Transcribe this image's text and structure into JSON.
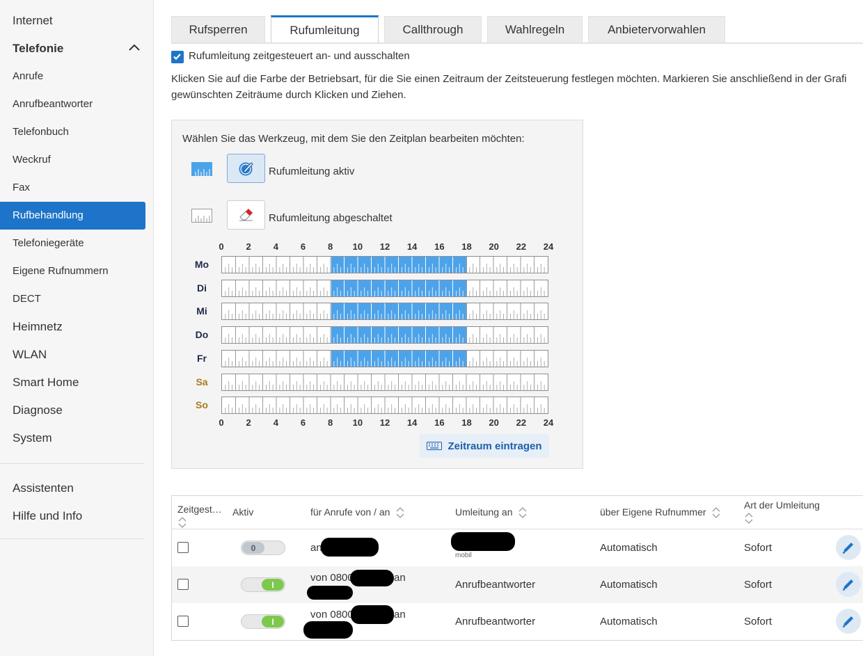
{
  "sidebar": {
    "items": [
      {
        "label": "Internet"
      },
      {
        "label": "Telefonie"
      },
      {
        "label": "Anrufe"
      },
      {
        "label": "Anrufbeantworter"
      },
      {
        "label": "Telefonbuch"
      },
      {
        "label": "Weckruf"
      },
      {
        "label": "Fax"
      },
      {
        "label": "Rufbehandlung"
      },
      {
        "label": "Telefoniegeräte"
      },
      {
        "label": "Eigene Rufnummern"
      },
      {
        "label": "DECT"
      },
      {
        "label": "Heimnetz"
      },
      {
        "label": "WLAN"
      },
      {
        "label": "Smart Home"
      },
      {
        "label": "Diagnose"
      },
      {
        "label": "System"
      },
      {
        "label": "Assistenten"
      },
      {
        "label": "Hilfe und Info"
      }
    ],
    "active": "Rufbehandlung"
  },
  "tabs": [
    {
      "label": "Rufsperren"
    },
    {
      "label": "Rufumleitung"
    },
    {
      "label": "Callthrough"
    },
    {
      "label": "Wahlregeln"
    },
    {
      "label": "Anbietervorwahlen"
    }
  ],
  "active_tab": "Rufumleitung",
  "timer": {
    "checkbox_label": "Rufumleitung zeitgesteuert an- und ausschalten",
    "checked": true,
    "instructions_line1": "Klicken Sie auf die Farbe der Betriebsart, für die Sie einen Zeitraum der Zeitsteuerung festlegen möchten. Markieren Sie anschließend in der Grafi",
    "instructions_line2": "gewünschten Zeiträume durch Klicken und Ziehen."
  },
  "tool_panel": {
    "heading": "Wählen Sie das Werkzeug, mit dem Sie den Zeitplan bearbeiten möchten:",
    "tool_active_label": "Rufumleitung aktiv",
    "tool_inactive_label": "Rufumleitung abgeschaltet",
    "hours": [
      "0",
      "2",
      "4",
      "6",
      "8",
      "10",
      "12",
      "14",
      "16",
      "18",
      "20",
      "22",
      "24"
    ],
    "days": [
      {
        "label": "Mo",
        "weekend": false,
        "active_from": 8,
        "active_to": 18
      },
      {
        "label": "Di",
        "weekend": false,
        "active_from": 8,
        "active_to": 18
      },
      {
        "label": "Mi",
        "weekend": false,
        "active_from": 8,
        "active_to": 18
      },
      {
        "label": "Do",
        "weekend": false,
        "active_from": 8,
        "active_to": 18
      },
      {
        "label": "Fr",
        "weekend": false,
        "active_from": 8,
        "active_to": 18
      },
      {
        "label": "Sa",
        "weekend": true,
        "active_from": null,
        "active_to": null
      },
      {
        "label": "So",
        "weekend": true,
        "active_from": null,
        "active_to": null
      }
    ],
    "enter_button": "Zeitraum eintragen",
    "colors": {
      "active": "#4da3ea",
      "weekend_label": "#a87a1c"
    }
  },
  "table": {
    "headers": [
      "Zeitgest…",
      "Aktiv",
      "für Anrufe von / an",
      "Umleitung an",
      "über Eigene Rufnummer",
      "Art der Umleitung"
    ],
    "rows": [
      {
        "aktiv": "0",
        "on": false,
        "calls": "an",
        "calls_suffix": "",
        "target": "",
        "target_sub": "mobil",
        "own_number": "Automatisch",
        "type": "Sofort"
      },
      {
        "aktiv": "I",
        "on": true,
        "calls": "von 0800",
        "calls_suffix": "an",
        "target": "Anrufbeantworter",
        "target_sub": "",
        "own_number": "Automatisch",
        "type": "Sofort"
      },
      {
        "aktiv": "I",
        "on": true,
        "calls": "von 0800",
        "calls_suffix": "an",
        "target": "Anrufbeantworter",
        "target_sub": "",
        "own_number": "Automatisch",
        "type": "Sofort"
      }
    ]
  }
}
